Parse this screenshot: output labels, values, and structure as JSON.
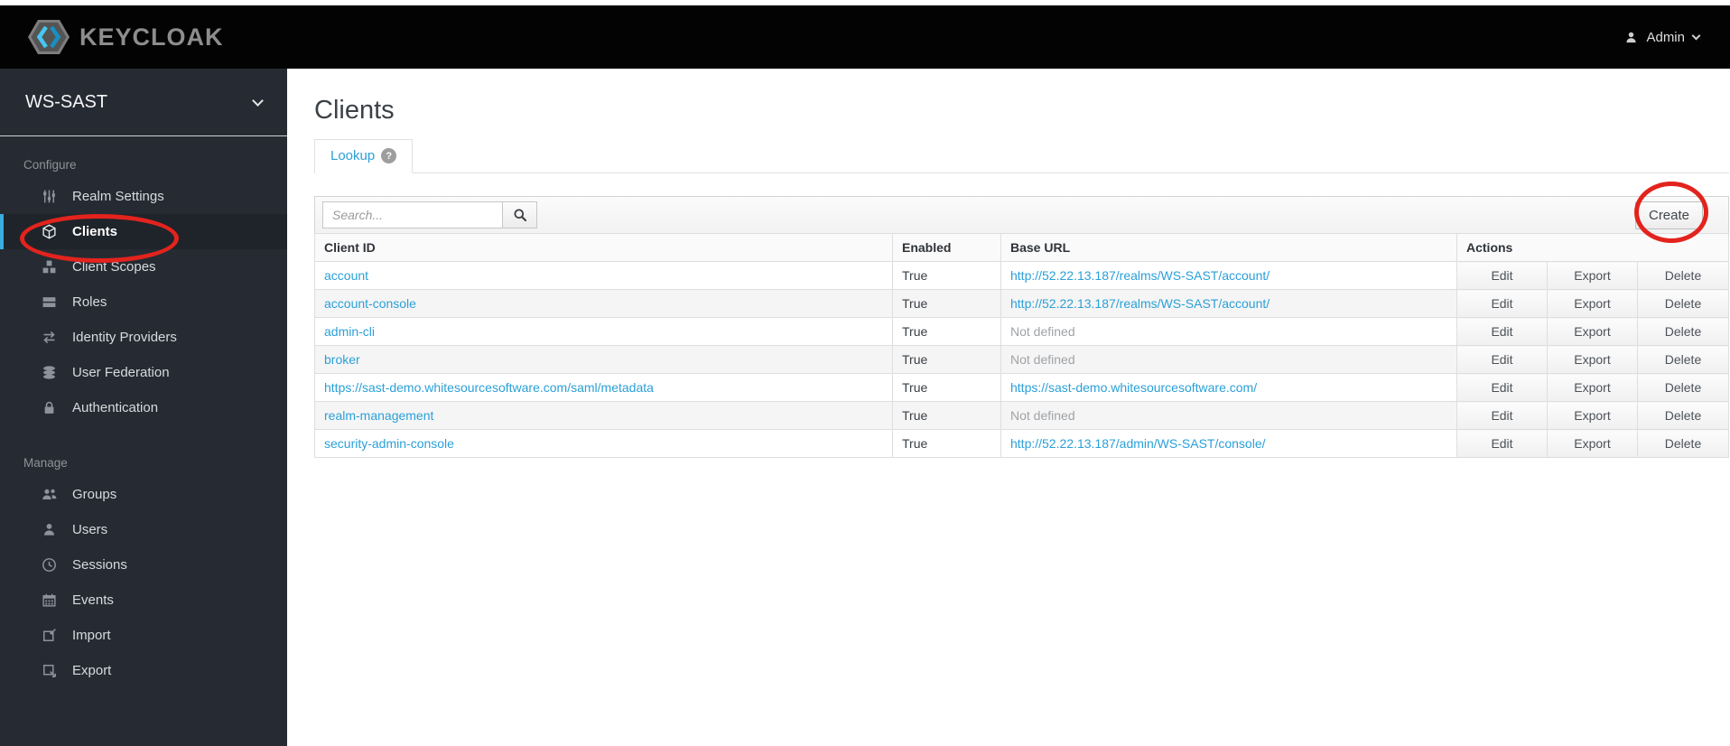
{
  "header": {
    "brand": "KEYCLOAK",
    "user_label": "Admin"
  },
  "sidebar": {
    "realm": "WS-SAST",
    "sections": [
      {
        "label": "Configure",
        "items": [
          {
            "label": "Realm Settings",
            "icon": "sliders-icon",
            "active": false
          },
          {
            "label": "Clients",
            "icon": "cube-icon",
            "active": true
          },
          {
            "label": "Client Scopes",
            "icon": "cubes-icon",
            "active": false
          },
          {
            "label": "Roles",
            "icon": "list-icon",
            "active": false
          },
          {
            "label": "Identity Providers",
            "icon": "exchange-arrows-icon",
            "active": false
          },
          {
            "label": "User Federation",
            "icon": "database-icon",
            "active": false
          },
          {
            "label": "Authentication",
            "icon": "lock-icon",
            "active": false
          }
        ]
      },
      {
        "label": "Manage",
        "items": [
          {
            "label": "Groups",
            "icon": "people-icon",
            "active": false
          },
          {
            "label": "Users",
            "icon": "person-icon",
            "active": false
          },
          {
            "label": "Sessions",
            "icon": "clock-icon",
            "active": false
          },
          {
            "label": "Events",
            "icon": "calendar-icon",
            "active": false
          },
          {
            "label": "Import",
            "icon": "import-icon",
            "active": false
          },
          {
            "label": "Export",
            "icon": "export-icon",
            "active": false
          }
        ]
      }
    ]
  },
  "main": {
    "title": "Clients",
    "tab": {
      "label": "Lookup",
      "help": "?"
    },
    "toolbar": {
      "search_placeholder": "Search...",
      "create_label": "Create"
    },
    "table": {
      "columns": [
        "Client ID",
        "Enabled",
        "Base URL",
        "Actions"
      ],
      "actions": [
        "Edit",
        "Export",
        "Delete"
      ],
      "rows": [
        {
          "client_id": "account",
          "enabled": "True",
          "base_url": "http://52.22.13.187/realms/WS-SAST/account/"
        },
        {
          "client_id": "account-console",
          "enabled": "True",
          "base_url": "http://52.22.13.187/realms/WS-SAST/account/"
        },
        {
          "client_id": "admin-cli",
          "enabled": "True",
          "base_url": "Not defined"
        },
        {
          "client_id": "broker",
          "enabled": "True",
          "base_url": "Not defined"
        },
        {
          "client_id": "https://sast-demo.whitesourcesoftware.com/saml/metadata",
          "enabled": "True",
          "base_url": "https://sast-demo.whitesourcesoftware.com/"
        },
        {
          "client_id": "realm-management",
          "enabled": "True",
          "base_url": "Not defined"
        },
        {
          "client_id": "security-admin-console",
          "enabled": "True",
          "base_url": "http://52.22.13.187/admin/WS-SAST/console/"
        }
      ]
    }
  },
  "annotations": {
    "color": "#e3231d",
    "targets": [
      "sidebar-item-clients",
      "create-button"
    ]
  },
  "colors": {
    "topbar_bg": "#030303",
    "sidebar_bg": "#262b33",
    "active_indicator": "#3bacde",
    "link_blue": "#2aa0d8",
    "annotation_red": "#e3231d"
  }
}
